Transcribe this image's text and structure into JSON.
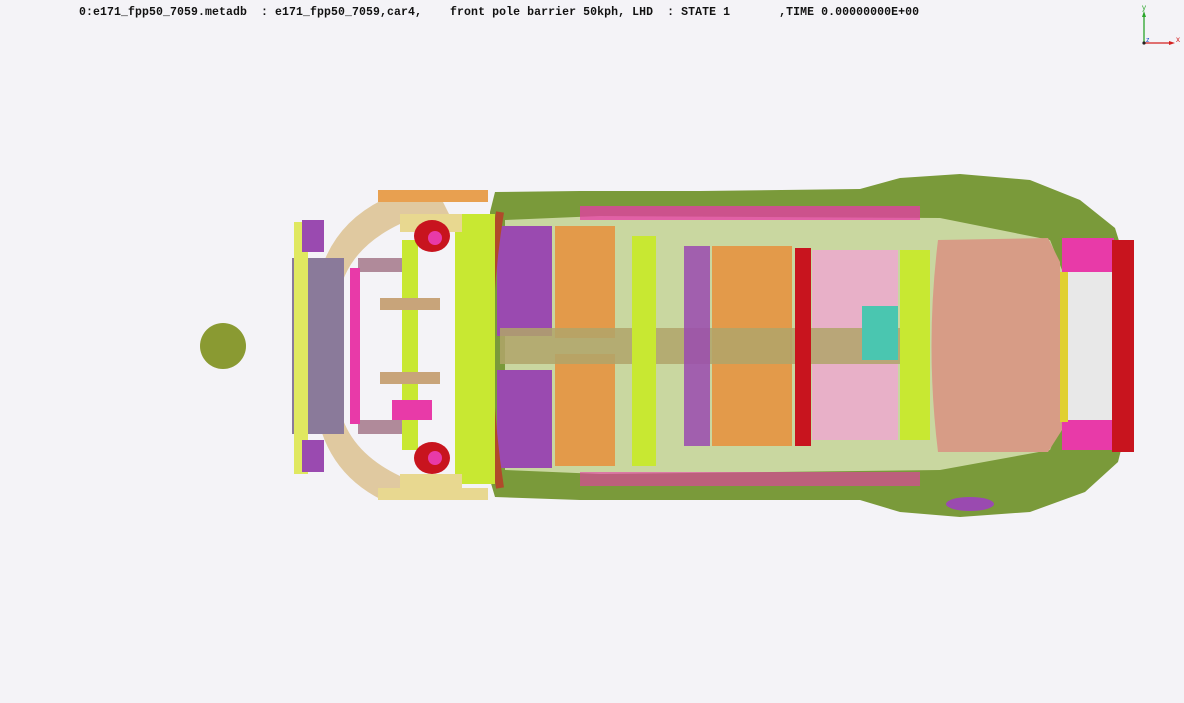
{
  "header": {
    "line": "0:e171_fpp50_7059.metadb  : e171_fpp50_7059,car4,    front pole barrier 50kph, LHD  : STATE 1       ,TIME 0.00000000E+00"
  },
  "axis_triad": {
    "y_label": "y",
    "x_label": "x",
    "z_label": "z",
    "y_color": "#2aa62a",
    "x_color": "#d42020",
    "z_color": "#2050d0"
  },
  "scene": {
    "barrier_color": "#8a9a32",
    "body_color": "#7a9a3a",
    "floor_color": "#e39a4a",
    "accent_colors": [
      "#e83aa8",
      "#9a4ab0",
      "#c8e832",
      "#b04a2a",
      "#e8b0c8",
      "#c8141e",
      "#8a7a9a"
    ]
  }
}
